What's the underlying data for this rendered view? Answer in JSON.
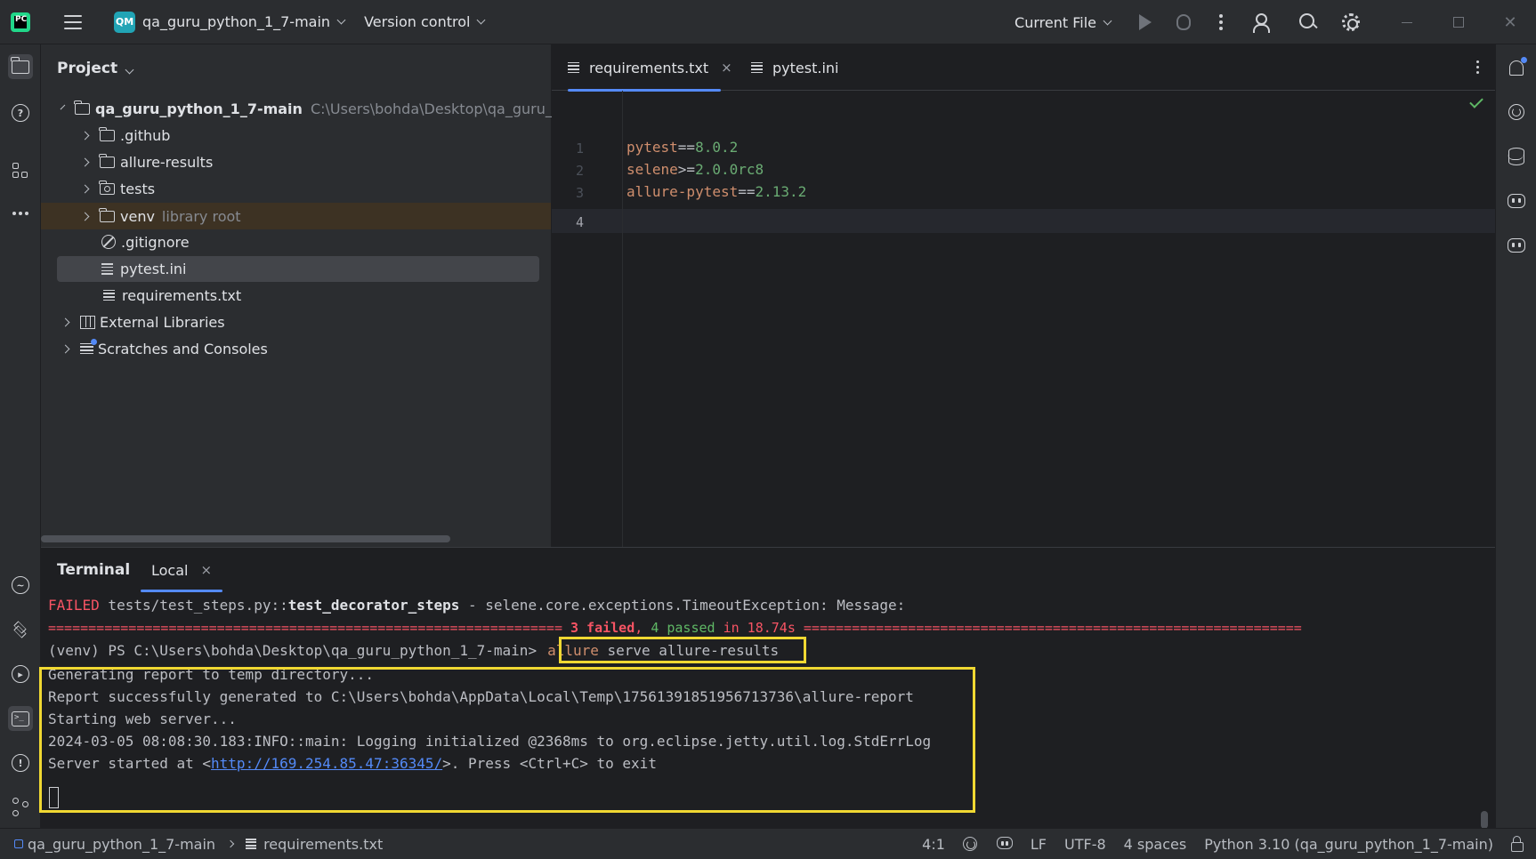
{
  "titlebar": {
    "logo_text": "PC",
    "project_badge": "QM",
    "project_name": "qa_guru_python_1_7-main",
    "version_control": "Version control",
    "run_config": "Current File",
    "icons": [
      "menu-icon",
      "run-icon",
      "debug-icon",
      "more-icon",
      "add-user-icon",
      "search-icon",
      "settings-icon",
      "minimize-icon",
      "maximize-icon",
      "close-icon"
    ]
  },
  "project_panel": {
    "title": "Project",
    "root": {
      "name": "qa_guru_python_1_7-main",
      "path": "C:\\Users\\bohda\\Desktop\\qa_guru_p"
    },
    "items": [
      {
        "name": ".github",
        "type": "folder"
      },
      {
        "name": "allure-results",
        "type": "folder"
      },
      {
        "name": "tests",
        "type": "test-folder"
      },
      {
        "name": "venv",
        "type": "folder",
        "hint": "library root"
      },
      {
        "name": ".gitignore",
        "type": "ignore-file"
      },
      {
        "name": "pytest.ini",
        "type": "file"
      },
      {
        "name": "requirements.txt",
        "type": "file"
      }
    ],
    "external_libraries": "External Libraries",
    "scratches": "Scratches and Consoles"
  },
  "editor": {
    "tabs": [
      {
        "label": "requirements.txt",
        "active": true
      },
      {
        "label": "pytest.ini",
        "active": false
      }
    ],
    "close_glyph": "×",
    "line_numbers": [
      "1",
      "2",
      "3",
      "4"
    ],
    "lines": [
      {
        "name": "pytest",
        "op": "==",
        "ver": "8.0.2"
      },
      {
        "name": "selene",
        "op": ">=",
        "ver": "2.0.0rc8"
      },
      {
        "name": "allure-pytest",
        "op": "==",
        "ver": "2.13.2"
      }
    ]
  },
  "terminal": {
    "title": "Terminal",
    "tab": "Local",
    "close_glyph": "×",
    "failed_label": "FAILED",
    "failed_path": " tests/test_steps.py::",
    "failed_test": "test_decorator_steps",
    "failed_msg": " - selene.core.exceptions.TimeoutException: Message:",
    "summary_left": "================================================================ ",
    "summary_failed": "3 failed",
    "summary_comma": ", ",
    "summary_passed": "4 passed",
    "summary_time": " in 18.74s ",
    "summary_right": "==============================================================",
    "prompt": "(venv) PS C:\\Users\\bohda\\Desktop\\qa_guru_python_1_7-main>",
    "cmd_allure": "allure",
    "cmd_rest": " serve allure-results",
    "output": [
      "Generating report to temp directory...",
      "Report successfully generated to C:\\Users\\bohda\\AppData\\Local\\Temp\\17561391851956713736\\allure-report",
      "Starting web server...",
      "2024-03-05 08:08:30.183:INFO::main: Logging initialized @2368ms to org.eclipse.jetty.util.log.StdErrLog"
    ],
    "server_prefix": "Server started at <",
    "server_url": "http://169.254.85.47:36345/",
    "server_suffix": ">. Press <Ctrl+C> to exit"
  },
  "statusbar": {
    "project": "qa_guru_python_1_7-main",
    "file": "requirements.txt",
    "position": "4:1",
    "line_sep": "LF",
    "encoding": "UTF-8",
    "indent": "4 spaces",
    "interpreter": "Python 3.10 (qa_guru_python_1_7-main)"
  },
  "colors": {
    "accent": "#548af7",
    "highlight_box": "#f0d832",
    "error": "#f75464",
    "success": "#5fb865"
  }
}
